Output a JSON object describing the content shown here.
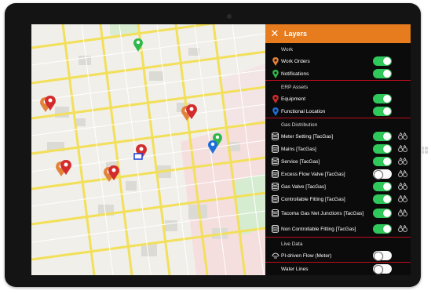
{
  "panel": {
    "title": "Layers",
    "sections": [
      {
        "heading": "Work",
        "items": [
          {
            "label": "Work Orders",
            "icon": "orange-pin-icon",
            "on": true,
            "filter": false
          },
          {
            "label": "Notifications",
            "icon": "green-pin-icon",
            "on": true,
            "filter": false
          }
        ]
      },
      {
        "heading": "ERP Assets",
        "items": [
          {
            "label": "Equipment",
            "icon": "red-pin-icon",
            "on": true,
            "filter": false
          },
          {
            "label": "Functional Location",
            "icon": "blue-pin-icon",
            "on": true,
            "filter": false
          }
        ]
      },
      {
        "heading": "Gas Distribution",
        "items": [
          {
            "label": "Meter Setting [TacGas]",
            "icon": "database-icon",
            "on": true,
            "filter": true
          },
          {
            "label": "Mains [TacGas]",
            "icon": "database-icon",
            "on": true,
            "filter": true
          },
          {
            "label": "Service [TacGas]",
            "icon": "database-icon",
            "on": true,
            "filter": true
          },
          {
            "label": "Excess Flow Valve [TacGas]",
            "icon": "database-icon",
            "on": false,
            "filter": true
          },
          {
            "label": "Gas Valve [TacGas]",
            "icon": "database-icon",
            "on": true,
            "filter": true
          },
          {
            "label": "Controllable Fitting [TacGas]",
            "icon": "database-icon",
            "on": true,
            "filter": true
          },
          {
            "label": "Tacoma Gas Net Junctions [TacGas]",
            "icon": "database-icon",
            "on": true,
            "filter": true
          },
          {
            "label": "Non Controllable Fitting [TacGas]",
            "icon": "database-icon",
            "on": true,
            "filter": true
          }
        ]
      },
      {
        "heading": "Live Data",
        "items": [
          {
            "label": "PI-driven Flow (Meter)",
            "icon": "flow-icon",
            "on": false,
            "filter": false
          }
        ]
      },
      {
        "heading": "",
        "items": [
          {
            "label": "Water Lines",
            "icon": "",
            "on": false,
            "filter": false
          }
        ]
      }
    ]
  },
  "colors": {
    "accent": "#e77c1e",
    "toggle_on": "#2fc85a",
    "divider": "#c00e1c"
  }
}
